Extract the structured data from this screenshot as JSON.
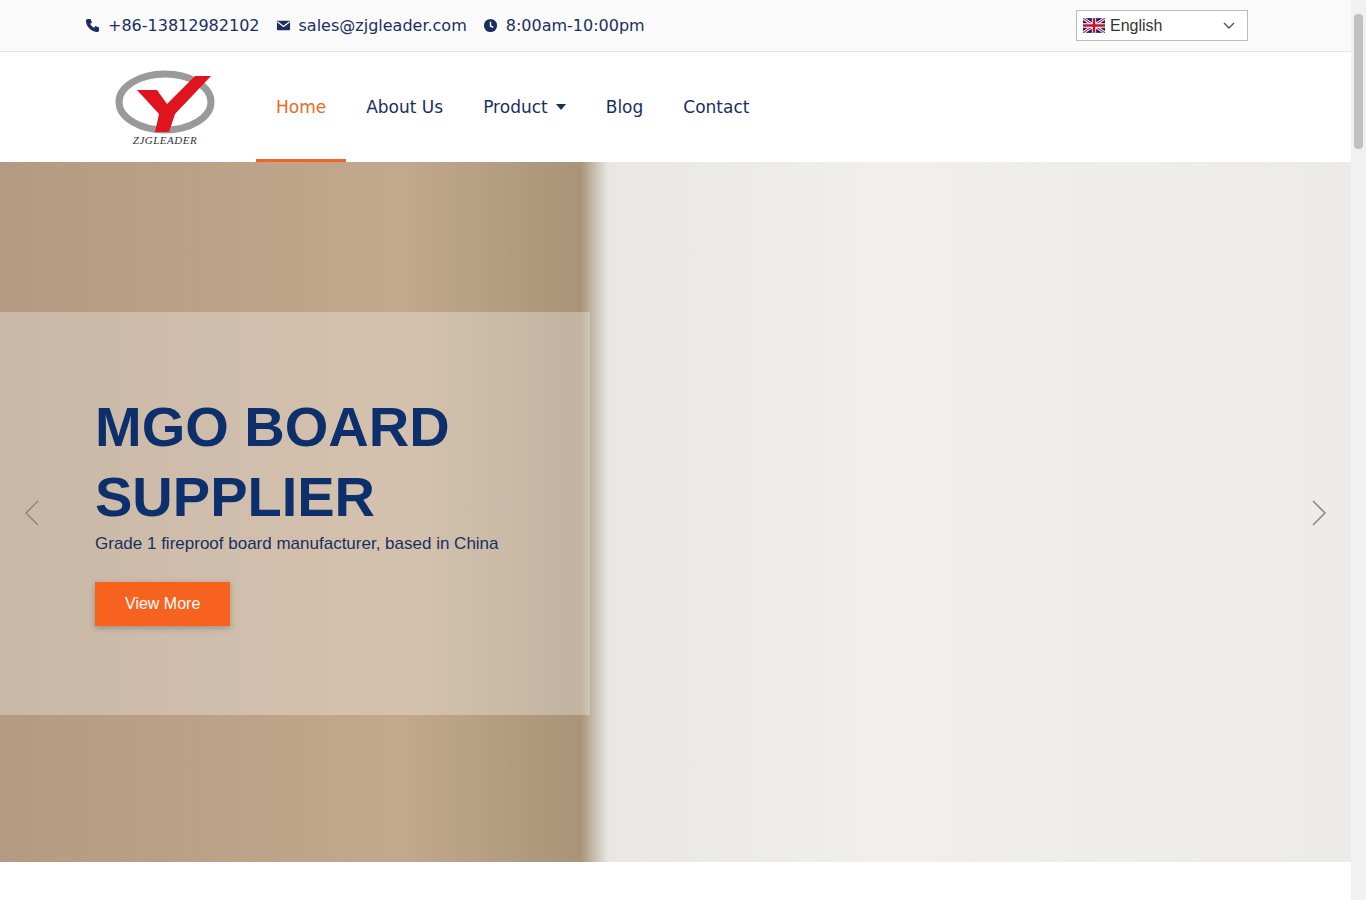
{
  "topbar": {
    "phone": "+86-13812982102",
    "email": "sales@zjgleader.com",
    "hours": "8:00am-10:00pm",
    "language": "English"
  },
  "logo": {
    "text": "ZJGLEADER"
  },
  "nav": [
    {
      "label": "Home",
      "selected": true,
      "dropdown": false
    },
    {
      "label": "About Us",
      "selected": false,
      "dropdown": false
    },
    {
      "label": "Product",
      "selected": false,
      "dropdown": true
    },
    {
      "label": "Blog",
      "selected": false,
      "dropdown": false
    },
    {
      "label": "Contact",
      "selected": false,
      "dropdown": false
    }
  ],
  "hero": {
    "title": "MGO BOARD SUPPLIER",
    "subtitle": "Grade 1 fireproof board manufacturer, based in China",
    "button": "View More"
  }
}
